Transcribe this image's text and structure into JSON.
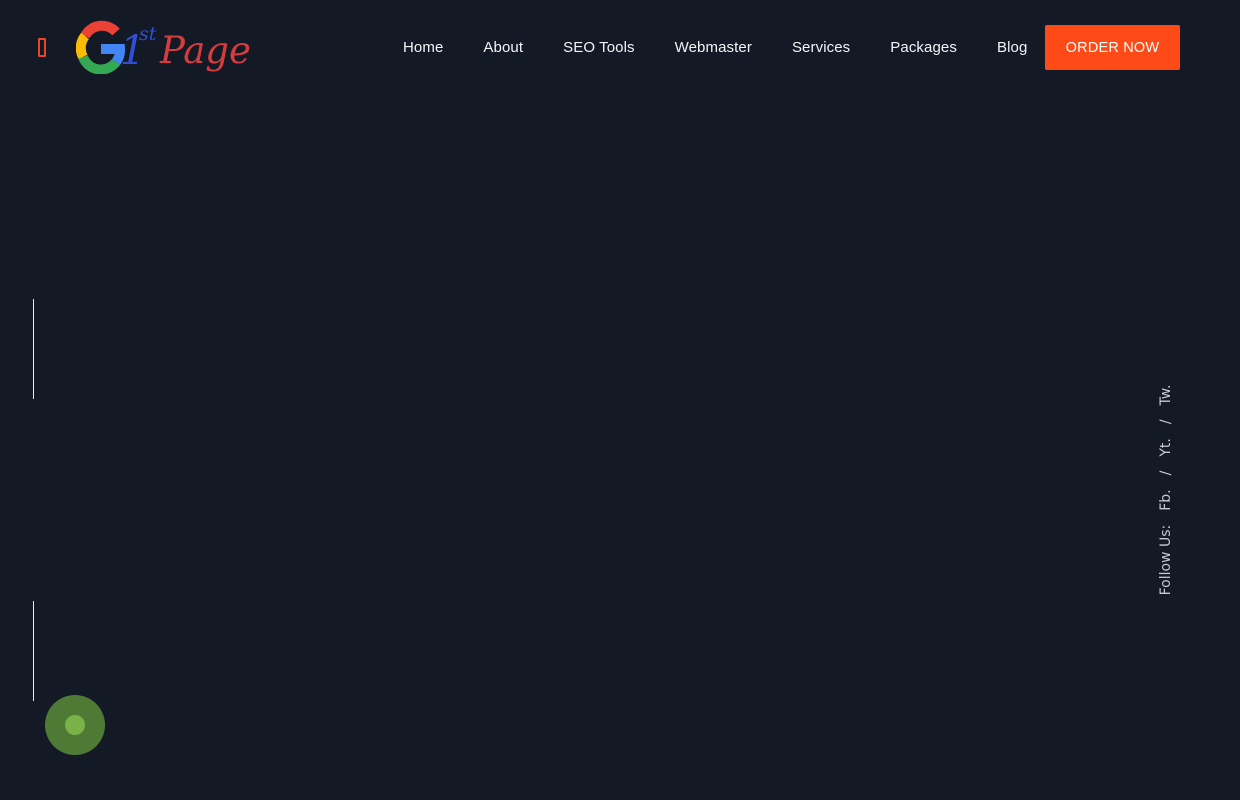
{
  "header": {
    "logo": {
      "big_letter": "G",
      "number": "1",
      "superscript": "st",
      "word": "Page"
    },
    "menu_icon": "menu-icon",
    "nav": [
      {
        "label": "Home"
      },
      {
        "label": "About"
      },
      {
        "label": "SEO Tools"
      },
      {
        "label": "Webmaster"
      },
      {
        "label": "Services"
      },
      {
        "label": "Packages"
      },
      {
        "label": "Blog"
      }
    ],
    "order_button": "ORDER NOW"
  },
  "social": {
    "label": "Follow Us:",
    "links": [
      "Fb.",
      "Yt.",
      "Tw."
    ],
    "separator": "/"
  },
  "floating_button": {
    "icon": "circle-dot-icon"
  },
  "colors": {
    "background": "#141a25",
    "accent": "#fd4a17",
    "menu_icon": "#e8452c",
    "float_button": "#4e7a36",
    "float_button_dot": "#79b347"
  }
}
